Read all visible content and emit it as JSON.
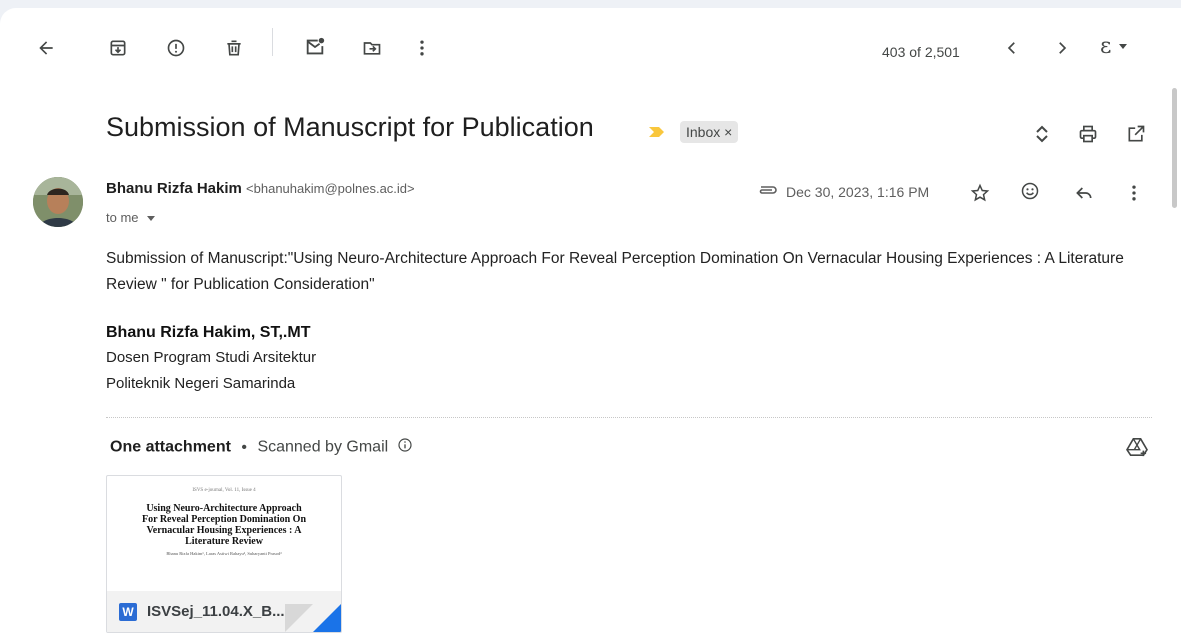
{
  "toolbar": {
    "counter": "403 of 2,501",
    "language_glyph": "ε"
  },
  "message": {
    "subject": "Submission of Manuscript for Publication",
    "label": "Inbox ×",
    "sender_name": "Bhanu Rizfa Hakim",
    "sender_email": "<bhanuhakim@polnes.ac.id>",
    "recipient": "to me",
    "date": "Dec 30, 2023, 1:16 PM",
    "body": "Submission of Manuscript:\"Using Neuro-Architecture Approach For Reveal Perception Domination On Vernacular Housing Experiences : A Literature Review \" for Publication Consideration\"",
    "signature": {
      "name": "Bhanu Rizfa Hakim, ST,.MT",
      "line1": "Dosen Program Studi Arsitektur",
      "line2": "Politeknik Negeri Samarinda"
    }
  },
  "attachments": {
    "title": "One attachment",
    "separator": "•",
    "scan_text": "Scanned by Gmail",
    "file": {
      "type_letter": "W",
      "name": "ISVSej_11.04.X_B...",
      "thumb_header": "ISVS e-journal, Vol. 11, Issue 4",
      "thumb_title": "Using Neuro-Architecture Approach For Reveal Perception Domination On Vernacular Housing Experiences : A Literature Review",
      "thumb_authors": "Bhanu Rizfa Hakim¹, Laras Astiwi Rahayu², Suharyanti Prasod³"
    }
  },
  "colors": {
    "accent": "#1a73e8",
    "important_marker": "#f9c73d",
    "word_blue": "#2b6cd4"
  }
}
